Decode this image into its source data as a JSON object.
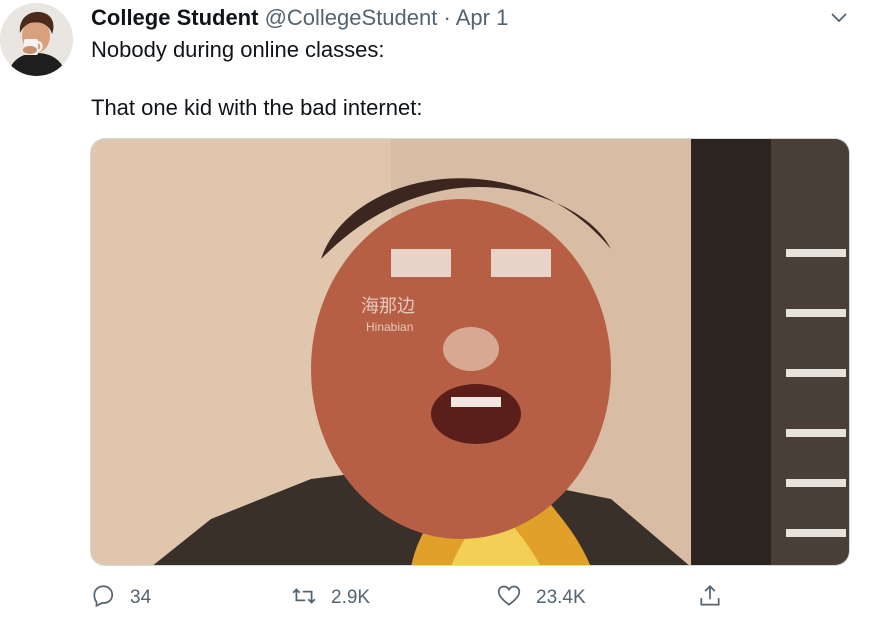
{
  "tweet": {
    "display_name": "College Student",
    "handle": "@CollegeStudent",
    "separator": "·",
    "date": "Apr 1",
    "text_line_1": "Nobody during online classes:",
    "text_line_2": "That one kid with the bad internet:",
    "media_watermark_cn": "海那边",
    "media_watermark_en": "Hinabian"
  },
  "actions": {
    "reply_count": "34",
    "retweet_count": "2.9K",
    "like_count": "23.4K"
  },
  "icons": {
    "menu": "chevron-down-icon",
    "reply": "reply-icon",
    "retweet": "retweet-icon",
    "like": "heart-icon",
    "share": "share-icon"
  },
  "colors": {
    "text_primary": "#0f1419",
    "text_secondary": "#536471"
  }
}
